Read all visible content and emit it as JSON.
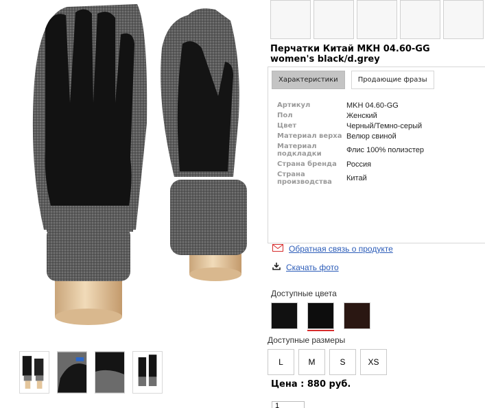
{
  "product": {
    "title": "Перчатки Китай MKH 04.60-GG women's black/d.grey"
  },
  "tabs": [
    {
      "label": "Характеристики",
      "active": true
    },
    {
      "label": "Продающие фразы",
      "active": false
    }
  ],
  "specs": [
    {
      "key": "Артикул",
      "value": "MKH 04.60-GG"
    },
    {
      "key": "Пол",
      "value": "Женский"
    },
    {
      "key": "Цвет",
      "value": "Черный/Темно-серый"
    },
    {
      "key": "Материал верха",
      "value": "Велюр свиной"
    },
    {
      "key": "Материал подкладки",
      "value": "Флис 100% полиэстер"
    },
    {
      "key": "Страна бренда",
      "value": "Россия"
    },
    {
      "key": "Страна производства",
      "value": "Китай"
    }
  ],
  "links": {
    "feedback": "Обратная связь о продукте",
    "download": "Скачать фото"
  },
  "colors": {
    "label": "Доступные цвета",
    "swatches": [
      {
        "name": "black",
        "hex": "#111111"
      },
      {
        "name": "black-grey",
        "hex": "#0d0d0d",
        "selected": true
      },
      {
        "name": "dark-brown",
        "hex": "#2a1712"
      }
    ]
  },
  "sizes": {
    "label": "Доступные размеры",
    "options": [
      "L",
      "M",
      "S",
      "XS"
    ]
  },
  "price": {
    "text": "Цена : 880 руб."
  },
  "quantity": {
    "value": "1"
  },
  "theme": {
    "link_color": "#2a5bb8",
    "selected_color": "#d62a2a",
    "knit_grey": "#5a5a5a",
    "stand_wood": "#e6c9a0"
  }
}
